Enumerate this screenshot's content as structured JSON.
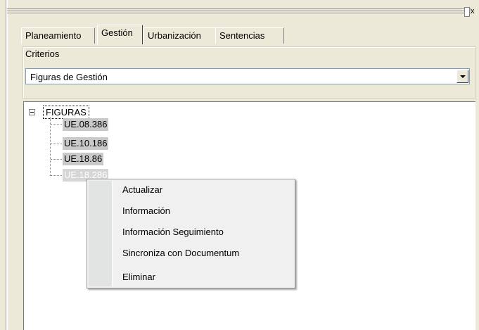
{
  "pane": {
    "close_glyph": "x"
  },
  "tabs": [
    {
      "label": "Planeamiento",
      "active": false
    },
    {
      "label": "Gestión",
      "active": true
    },
    {
      "label": "Urbanización",
      "active": false
    },
    {
      "label": "Sentencias",
      "active": false
    }
  ],
  "criterios": {
    "group_label": "Criterios",
    "selected": "Figuras de Gestión"
  },
  "tree": {
    "root": {
      "label": "FIGURAS",
      "expanded": true
    },
    "children": [
      "UE.08.386",
      "UE.10.186",
      "UE.18.86",
      "UE.18.286"
    ]
  },
  "context_menu": {
    "items": [
      "Actualizar",
      "Información",
      "Información Seguimiento",
      "Sincroniza con Documentum",
      "Eliminar"
    ]
  },
  "colors": {
    "window_bg": "#ece9d8",
    "selection_gray": "#c9c9c9",
    "menu_bg": "#f0f0f0",
    "combo_border": "#7f9db9"
  }
}
